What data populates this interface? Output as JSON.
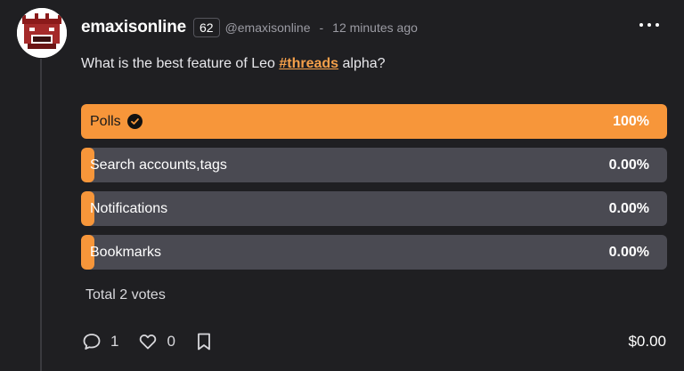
{
  "post": {
    "username": "emaxisonline",
    "reputation": "62",
    "handle": "@emaxisonline",
    "separator": "-",
    "time_ago": "12 minutes ago",
    "question_prefix": "What is the best feature of Leo ",
    "hashtag": "#threads",
    "question_suffix": " alpha?"
  },
  "poll": {
    "options": [
      {
        "label": "Polls",
        "percent_text": "100%",
        "fraction": 1.0,
        "selected": true
      },
      {
        "label": "Search accounts,tags",
        "percent_text": "0.00%",
        "fraction": 0.0,
        "selected": false
      },
      {
        "label": "Notifications",
        "percent_text": "0.00%",
        "fraction": 0.0,
        "selected": false
      },
      {
        "label": "Bookmarks",
        "percent_text": "0.00%",
        "fraction": 0.0,
        "selected": false
      }
    ],
    "total_votes": "Total 2 votes"
  },
  "actions": {
    "comments_count": "1",
    "likes_count": "0",
    "payout": "$0.00"
  },
  "icons": {
    "check": "check-circle-icon",
    "comment": "comment-icon",
    "like": "heart-icon",
    "bookmark": "bookmark-icon",
    "more": "more-dots-icon"
  },
  "colors": {
    "accent": "#f7963a",
    "background": "#1f1f22",
    "option_track": "#4a4a52"
  }
}
